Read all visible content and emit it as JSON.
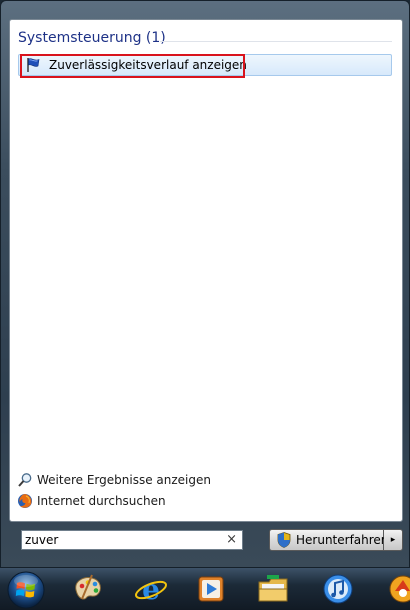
{
  "results": {
    "group_header": "Systemsteuerung (1)",
    "items": [
      {
        "label": "Zuverlässigkeitsverlauf anzeigen",
        "icon": "blue-flag-icon",
        "highlighted": true
      }
    ]
  },
  "links": {
    "more_results": "Weitere Ergebnisse anzeigen",
    "search_internet": "Internet durchsuchen"
  },
  "search": {
    "value": "zuver",
    "clear_glyph": "×"
  },
  "shutdown": {
    "label": "Herunterfahren",
    "arrow_glyph": "▸"
  },
  "taskbar": {
    "icons": [
      "start-orb-icon",
      "paint-palette-icon",
      "internet-explorer-icon",
      "media-player-icon",
      "file-explorer-icon",
      "itunes-icon",
      "partial-app-icon"
    ]
  },
  "colors": {
    "highlight_border": "#d9131c",
    "group_header_text": "#1e3287",
    "selection_fill": "#d7e9fb"
  }
}
